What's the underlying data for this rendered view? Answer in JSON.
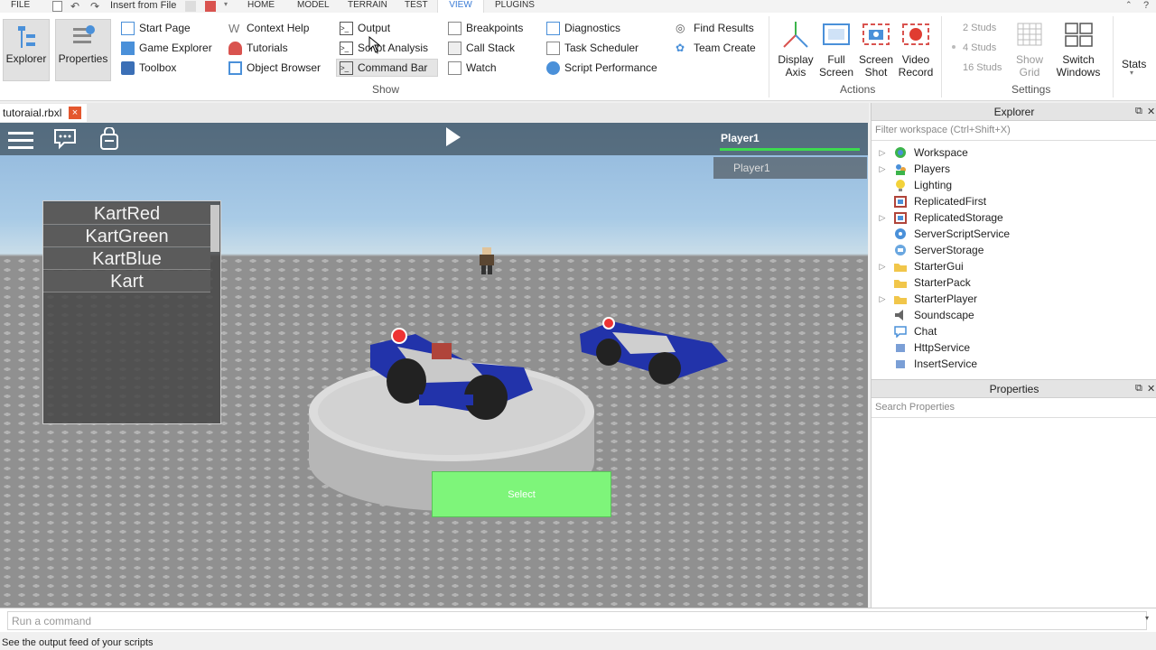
{
  "menubar": {
    "file": "FILE",
    "insert_from_file": "Insert from File",
    "tabs": [
      "HOME",
      "MODEL",
      "TERRAIN",
      "TEST",
      "VIEW",
      "PLUGINS"
    ]
  },
  "ribbon": {
    "explorer": "Explorer",
    "properties": "Properties",
    "col1": [
      "Start Page",
      "Game Explorer",
      "Toolbox"
    ],
    "col2": [
      "Context Help",
      "Tutorials",
      "Object Browser"
    ],
    "col3": [
      "Output",
      "Script Analysis",
      "Command Bar"
    ],
    "col4": [
      "Breakpoints",
      "Call Stack",
      "Watch"
    ],
    "col5": [
      "Diagnostics",
      "Task Scheduler",
      "Script Performance"
    ],
    "col6": [
      "Find Results",
      "Team Create"
    ],
    "show_group": "Show",
    "display_axis": [
      "Display",
      "Axis"
    ],
    "full_screen": [
      "Full",
      "Screen"
    ],
    "screen_shot": [
      "Screen",
      "Shot"
    ],
    "video_record": [
      "Video",
      "Record"
    ],
    "actions_group": "Actions",
    "studs": [
      "2 Studs",
      "4 Studs",
      "16 Studs"
    ],
    "show_grid": [
      "Show",
      "Grid"
    ],
    "switch_windows": [
      "Switch",
      "Windows"
    ],
    "settings_group": "Settings",
    "stats": "Stats"
  },
  "doc_tab": {
    "name": "tutoraial.rbxl",
    "close": "×"
  },
  "game": {
    "player_title": "Player1",
    "player_entry": "Player1",
    "kart_items": [
      "KartRed",
      "KartGreen",
      "KartBlue",
      "Kart"
    ],
    "select_label": "Select"
  },
  "explorer": {
    "title": "Explorer",
    "filter_placeholder": "Filter workspace (Ctrl+Shift+X)",
    "items": [
      "Workspace",
      "Players",
      "Lighting",
      "ReplicatedFirst",
      "ReplicatedStorage",
      "ServerScriptService",
      "ServerStorage",
      "StarterGui",
      "StarterPack",
      "StarterPlayer",
      "Soundscape",
      "Chat",
      "HttpService",
      "InsertService"
    ]
  },
  "properties": {
    "title": "Properties",
    "search_placeholder": "Search Properties"
  },
  "command": {
    "placeholder": "Run a command"
  },
  "status": {
    "text": "See the output feed of your scripts"
  },
  "colors": {
    "accent": "#3a7bd5",
    "select_green": "#7ef57a",
    "player_bar": "#3ddb4f",
    "close_red": "#e4572e"
  }
}
